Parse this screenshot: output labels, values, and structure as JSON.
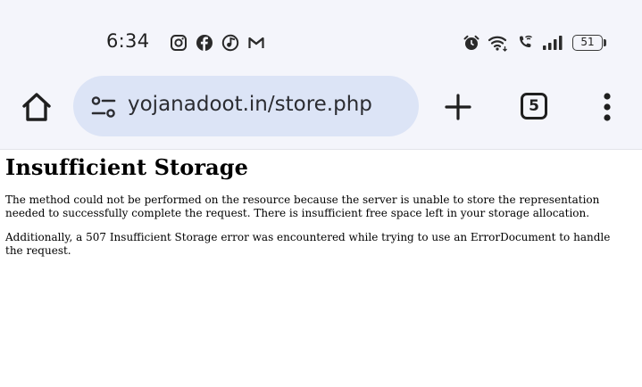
{
  "status_bar": {
    "time": "6:34",
    "battery_level": "51",
    "app_icons": [
      "instagram-icon",
      "facebook-icon",
      "music-icon",
      "gmail-icon"
    ],
    "system_icons": [
      "alarm-icon",
      "wifi-icon",
      "wifi-calling-icon",
      "signal-icon",
      "battery-icon"
    ]
  },
  "toolbar": {
    "url": "yojanadoot.in/store.php",
    "tab_count": "5",
    "url_bar_color": "#dce4f6"
  },
  "page": {
    "title": "Insufficient Storage",
    "paragraph1": "The method could not be performed on the resource because the server is unable to store the representation needed to successfully complete the request. There is insufficient free space left in your storage allocation.",
    "paragraph2": "Additionally, a 507 Insufficient Storage error was encountered while trying to use an ErrorDocument to handle the request."
  }
}
